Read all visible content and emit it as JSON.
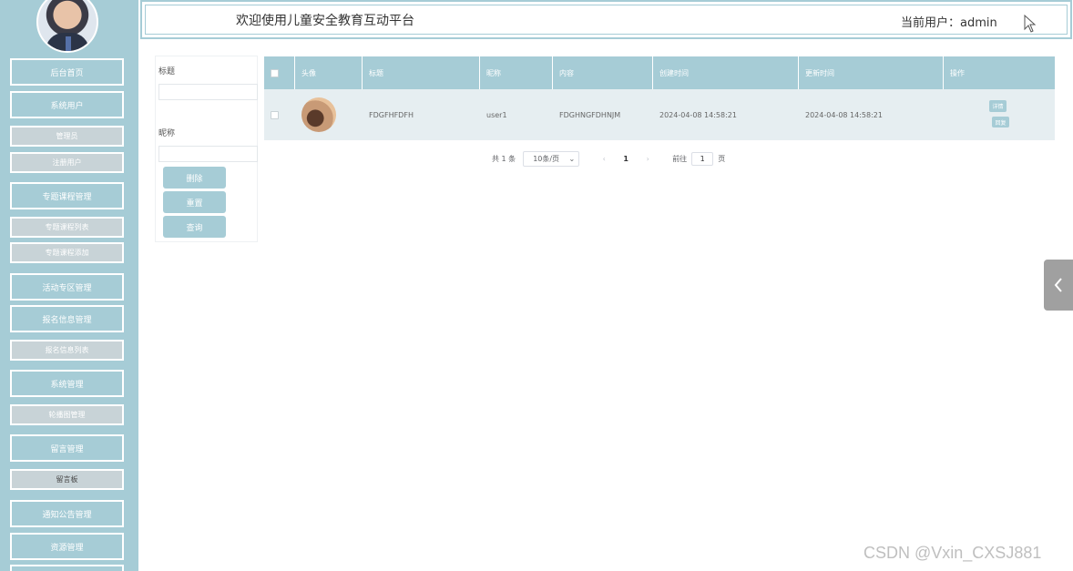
{
  "header": {
    "title": "欢迎使用儿童安全教育互动平台",
    "user_label": "当前用户：admin"
  },
  "sidebar": {
    "items": [
      {
        "label": "后台首页",
        "type": "main"
      },
      {
        "label": "系统用户",
        "type": "main"
      },
      {
        "label": "管理员",
        "type": "sub"
      },
      {
        "label": "注册用户",
        "type": "sub"
      },
      {
        "label": "专题课程管理",
        "type": "main"
      },
      {
        "label": "专题课程列表",
        "type": "sub"
      },
      {
        "label": "专题课程添加",
        "type": "sub"
      },
      {
        "label": "活动专区管理",
        "type": "main"
      },
      {
        "label": "报名信息管理",
        "type": "main"
      },
      {
        "label": "报名信息列表",
        "type": "sub"
      },
      {
        "label": "系统管理",
        "type": "main"
      },
      {
        "label": "轮播图管理",
        "type": "sub"
      },
      {
        "label": "留言管理",
        "type": "main"
      },
      {
        "label": "留言板",
        "type": "sub-dark"
      },
      {
        "label": "通知公告管理",
        "type": "main"
      },
      {
        "label": "资源管理",
        "type": "main"
      }
    ]
  },
  "search": {
    "title_label": "标题",
    "nickname_label": "昵称",
    "title_value": "",
    "nickname_value": "",
    "buttons": {
      "delete": "删除",
      "reset": "重置",
      "query": "查询"
    }
  },
  "table": {
    "columns": [
      "头像",
      "标题",
      "昵称",
      "内容",
      "创建时间",
      "更新时间",
      "操作"
    ],
    "rows": [
      {
        "title": "FDGFHFDFH",
        "nickname": "user1",
        "content": "FDGHNGFDHNJM",
        "created": "2024-04-08 14:58:21",
        "updated": "2024-04-08 14:58:21",
        "actions": [
          "详情",
          "回复"
        ]
      }
    ]
  },
  "pagination": {
    "total": "共 1 条",
    "page_size": "10条/页",
    "current_page": "1",
    "goto_label": "前往",
    "goto_value": "1",
    "page_suffix": "页"
  },
  "watermark": "CSDN @Vxin_CXSJ881",
  "colors": {
    "accent": "#a6ccd6",
    "sub_menu": "#c8d3d7",
    "row_bg": "#e6eef1"
  }
}
